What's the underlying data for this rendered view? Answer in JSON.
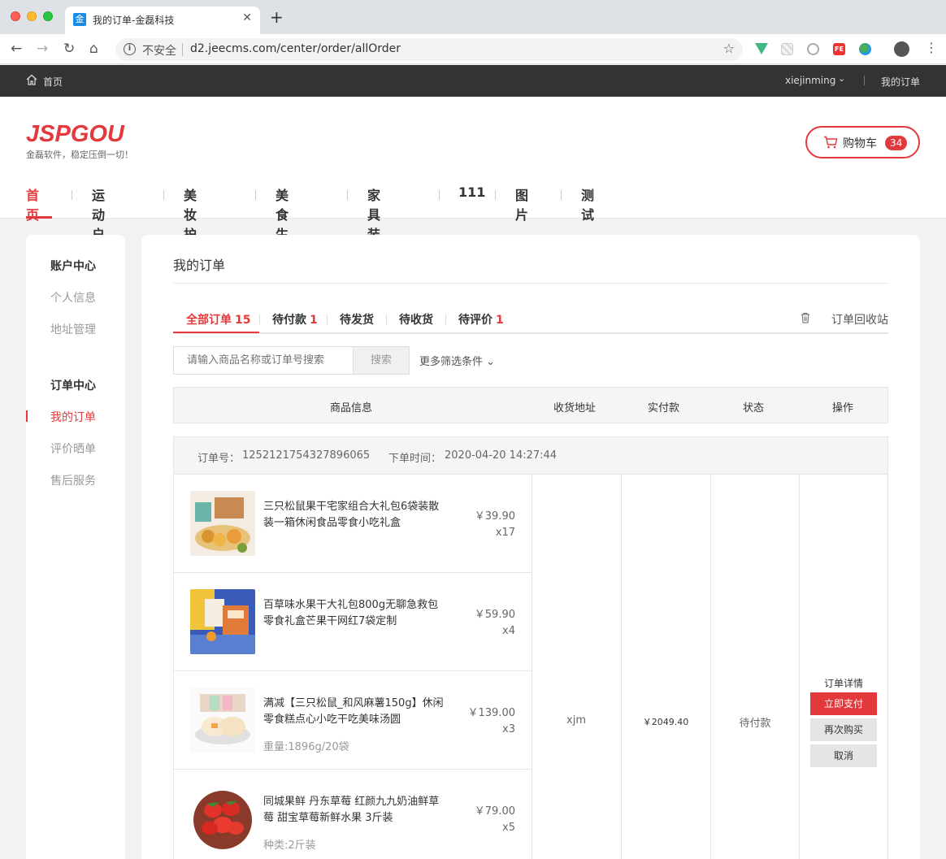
{
  "browser": {
    "tab_title": "我的订单-金磊科技",
    "tab_favicon": "金",
    "insecure_label": "不安全",
    "url": "d2.jeecms.com/center/order/allOrder"
  },
  "topbar": {
    "home": "首页",
    "user": "xiejinming",
    "my_orders": "我的订单"
  },
  "header": {
    "logo": "JSPGOU",
    "slogan": "金磊软件，稳定压倒一切！",
    "cart_label": "购物车",
    "cart_count": "34",
    "nav": [
      "首页",
      "运动户外",
      "美妆护理",
      "美食生鲜",
      "家具装饰",
      "111",
      "图片",
      "测试"
    ]
  },
  "sidebar": {
    "account_head": "账户中心",
    "account_items": [
      "个人信息",
      "地址管理"
    ],
    "order_head": "订单中心",
    "order_items": [
      "我的订单",
      "评价晒单",
      "售后服务"
    ]
  },
  "main": {
    "title": "我的订单",
    "tabs": [
      {
        "label": "全部订单",
        "count": "15"
      },
      {
        "label": "待付款",
        "count": "1"
      },
      {
        "label": "待发货",
        "count": ""
      },
      {
        "label": "待收货",
        "count": ""
      },
      {
        "label": "待评价",
        "count": "1"
      }
    ],
    "recycle": "订单回收站",
    "search_placeholder": "请输入商品名称或订单号搜索",
    "search_btn": "搜索",
    "more_filter": "更多筛选条件",
    "columns": [
      "商品信息",
      "收货地址",
      "实付款",
      "状态",
      "操作"
    ]
  },
  "order": {
    "no_label": "订单号：",
    "no": "1252121754327896065",
    "time_label": "下单时间：",
    "time": "2020-04-20 14:27:44",
    "receiver": "xjm",
    "paid": "￥2049.40",
    "status": "待付款",
    "actions": {
      "detail": "订单详情",
      "pay": "立即支付",
      "rebuy": "再次购买",
      "cancel": "取消"
    },
    "items": [
      {
        "name": "三只松鼠果干宅家组合大礼包6袋装散装一箱休闲食品零食小吃礼盒",
        "spec": "",
        "price": "￥39.90",
        "qty": "x17"
      },
      {
        "name": "百草味水果干大礼包800g无聊急救包 零食礼盒芒果干网红7袋定制",
        "spec": "",
        "price": "￥59.90",
        "qty": "x4"
      },
      {
        "name": "满减【三只松鼠_和风麻薯150g】休闲零食糕点心小吃干吃美味汤圆",
        "spec": "重量:1896g/20袋",
        "price": "￥139.00",
        "qty": "x3"
      },
      {
        "name": "同城果鲜 丹东草莓 红颜九九奶油鲜草莓 甜宝草莓新鲜水果 3斤装",
        "spec": "种类:2斤装",
        "price": "￥79.00",
        "qty": "x5"
      }
    ]
  },
  "colors": {
    "accent": "#e4393c",
    "topbar": "#333333",
    "page_bg": "#f2f2f2"
  }
}
